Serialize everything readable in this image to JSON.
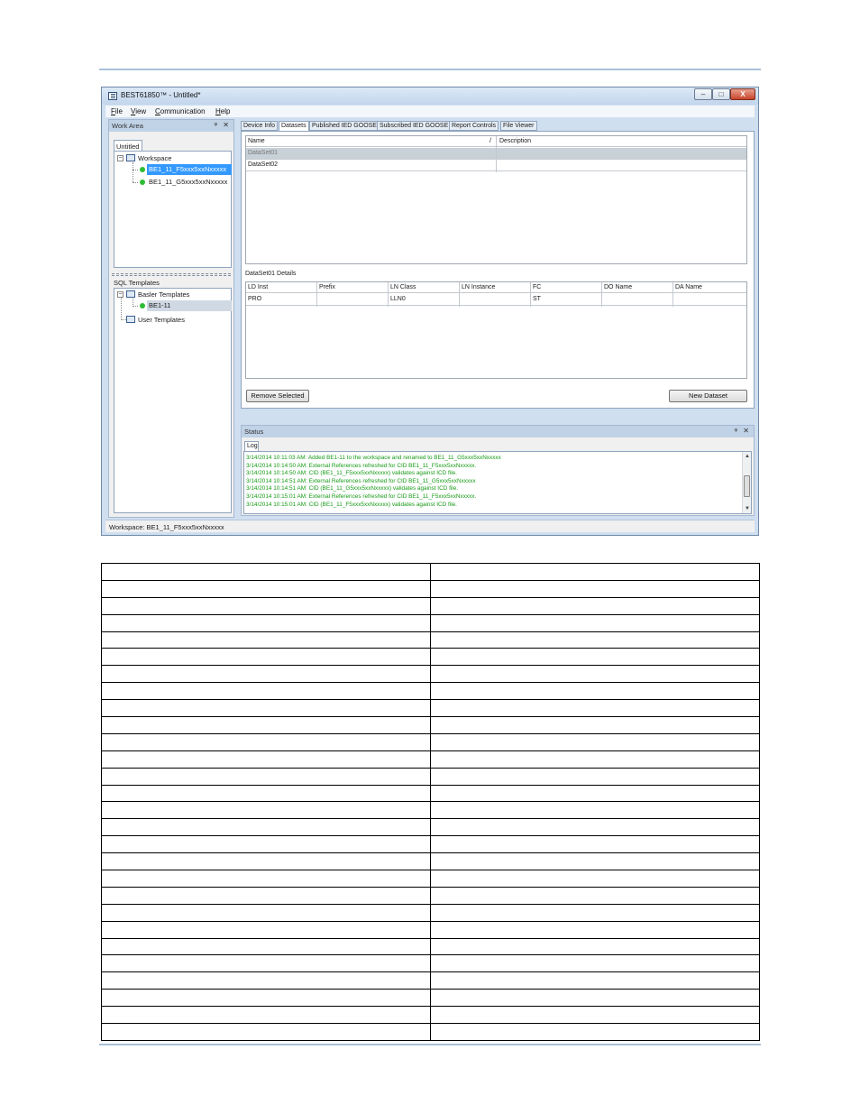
{
  "window": {
    "title": "BEST61850™ - Untitled*",
    "controls": {
      "minimize": "–",
      "maximize": "□",
      "close": "X"
    }
  },
  "menu": [
    "File",
    "View",
    "Communication",
    "Help"
  ],
  "work_area": {
    "title": "Work Area",
    "pane_buttons": "ᵠ ✕",
    "doc_tab": "Untitled",
    "workspace_label": "Workspace",
    "workspace_devices": [
      "BE1_11_F5xxx5xxNxxxxx",
      "BE1_11_G5xxx5xxNxxxxx"
    ],
    "sql_title": "SQL Templates",
    "basler_templates": "Basler Templates",
    "basler_child": "BE1-11",
    "user_templates": "User Templates"
  },
  "tabs": [
    "Device Info",
    "Datasets",
    "Published IED GOOSE",
    "Subscribed IED GOOSE",
    "Report Controls",
    "File Viewer"
  ],
  "datasets": {
    "columns": [
      "Name",
      "Description"
    ],
    "sort_marker": "/",
    "rows": [
      {
        "name": "DataSet01",
        "description": ""
      },
      {
        "name": "DataSet02",
        "description": ""
      }
    ]
  },
  "details": {
    "label": "DataSet01 Details",
    "columns": [
      "LD Inst",
      "Prefix",
      "LN Class",
      "LN Instance",
      "FC",
      "DO Name",
      "DA Name"
    ],
    "rows": [
      [
        "PRO",
        "",
        "LLN0",
        "",
        "ST",
        "",
        ""
      ]
    ]
  },
  "buttons": {
    "remove_selected": "Remove Selected",
    "new_dataset": "New Dataset"
  },
  "status": {
    "title": "Status",
    "pane_buttons": "ᵠ ✕",
    "log_tab": "Log",
    "log_lines": [
      "3/14/2014 10:11:03 AM: Added BE1-11 to the workspace and renamed to BE1_11_G5xxx5xxNxxxxx",
      "3/14/2014 10:14:50 AM: External References refreshed for CID BE1_11_F5xxx5xxNxxxxx.",
      "3/14/2014 10:14:50 AM: CID (BE1_11_F5xxx5xxNxxxxx) validates against ICD file.",
      "3/14/2014 10:14:51 AM: External References refreshed for CID BE1_11_G5xxx5xxNxxxxx",
      "3/14/2014 10:14:51 AM: CID (BE1_11_G5xxx5xxNxxxxx) validates against ICD file.",
      "3/14/2014 10:15:01 AM: External References refreshed for CID BE1_11_F5xxx5xxNxxxxx.",
      "3/14/2014 10:15:01 AM: CID (BE1_11_F5xxx5xxNxxxxx) validates against ICD file."
    ]
  },
  "statusbar": {
    "text": "Workspace: BE1_11_F5xxx5xxNxxxxx"
  },
  "colors": {
    "selection": "#3399ff",
    "log_text": "#169a16",
    "status_dot": "#2ebc33",
    "frame": "#cfdff0"
  }
}
